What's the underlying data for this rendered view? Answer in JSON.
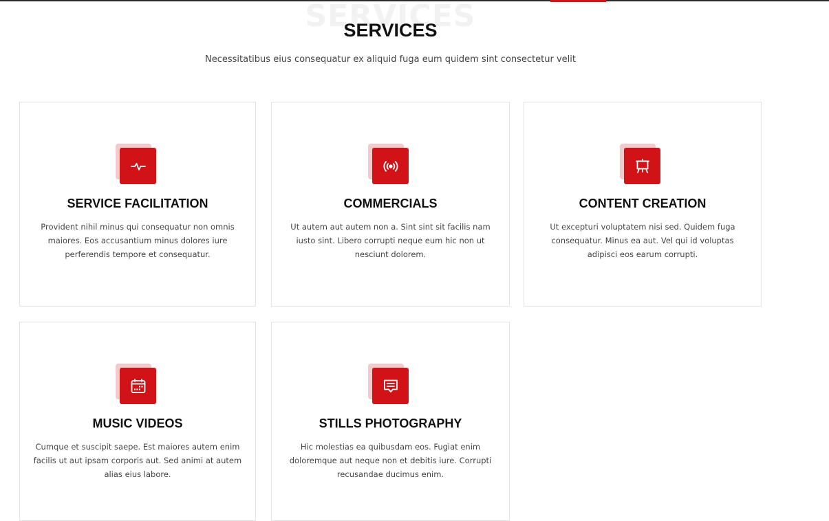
{
  "section": {
    "background_title": "SERVICES",
    "title": "SERVICES",
    "subtitle": "Necessitatibus eius consequatur ex aliquid fuga eum quidem sint consectetur velit"
  },
  "colors": {
    "accent": "#d11317",
    "accent_light": "#f3c9cb",
    "heading": "#111111",
    "body_text": "#444444",
    "card_border": "#e3e3e3"
  },
  "services": [
    {
      "icon": "activity-icon",
      "title": "SERVICE FACILITATION",
      "text": "Provident nihil minus qui consequatur non omnis maiores. Eos accusantium minus dolores iure perferendis tempore et consequatur."
    },
    {
      "icon": "broadcast-icon",
      "title": "COMMERCIALS",
      "text": "Ut autem aut autem non a. Sint sint sit facilis nam iusto sint. Libero corrupti neque eum hic non ut nesciunt dolorem."
    },
    {
      "icon": "easel-icon",
      "title": "CONTENT CREATION",
      "text": "Ut excepturi voluptatem nisi sed. Quidem fuga consequatur. Minus ea aut. Vel qui id voluptas adipisci eos earum corrupti."
    },
    {
      "icon": "calendar-icon",
      "title": "MUSIC VIDEOS",
      "text": "Cumque et suscipit saepe. Est maiores autem enim facilis ut aut ipsam corporis aut. Sed animi at autem alias eius labore."
    },
    {
      "icon": "chat-square-text-icon",
      "title": "STILLS PHOTOGRAPHY",
      "text": "Hic molestias ea quibusdam eos. Fugiat enim doloremque aut neque non et debitis iure. Corrupti recusandae ducimus enim."
    }
  ]
}
